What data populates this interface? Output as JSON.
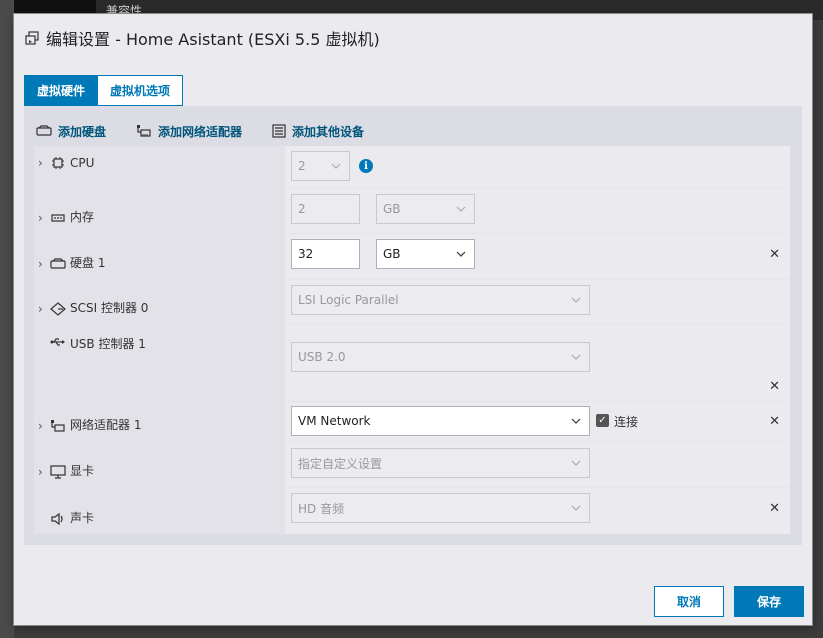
{
  "background": {
    "partial_text": "兼容性"
  },
  "dialog": {
    "title": "编辑设置 - Home Asistant (ESXi 5.5 虚拟机)"
  },
  "tabs": [
    {
      "label": "虚拟硬件",
      "active": true
    },
    {
      "label": "虚拟机选项",
      "active": false
    }
  ],
  "toolbar": {
    "add_disk": "添加硬盘",
    "add_nic": "添加网络适配器",
    "add_other": "添加其他设备"
  },
  "rows": {
    "cpu": {
      "label": "CPU",
      "value": "2",
      "info": "i"
    },
    "memory": {
      "label": "内存",
      "value": "2",
      "unit": "GB"
    },
    "disk": {
      "label": "硬盘 1",
      "value": "32",
      "unit": "GB"
    },
    "scsi": {
      "label": "SCSI 控制器 0",
      "value": "LSI Logic Parallel"
    },
    "usb": {
      "label": "USB 控制器 1",
      "value": "USB 2.0"
    },
    "nic": {
      "label": "网络适配器 1",
      "value": "VM Network",
      "connect_label": "连接",
      "connected": true
    },
    "video": {
      "label": "显卡",
      "value": "指定自定义设置"
    },
    "sound": {
      "label": "声卡",
      "value": "HD 音频"
    }
  },
  "footer": {
    "cancel": "取消",
    "save": "保存"
  },
  "colors": {
    "accent": "#0079b8",
    "panel": "#dcdce4",
    "dialog_bg": "#ebebef"
  }
}
